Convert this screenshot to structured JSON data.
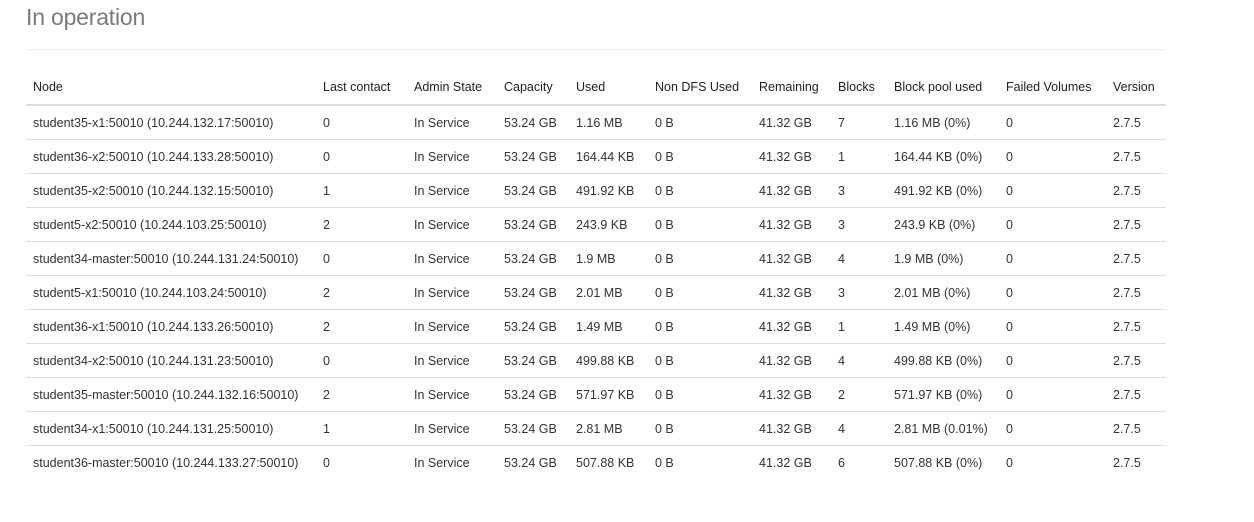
{
  "section": {
    "title": "In operation"
  },
  "table": {
    "headers": [
      "Node",
      "Last contact",
      "Admin State",
      "Capacity",
      "Used",
      "Non DFS Used",
      "Remaining",
      "Blocks",
      "Block pool used",
      "Failed Volumes",
      "Version"
    ],
    "rows": [
      [
        "student35-x1:50010 (10.244.132.17:50010)",
        "0",
        "In Service",
        "53.24 GB",
        "1.16 MB",
        "0 B",
        "41.32 GB",
        "7",
        "1.16 MB (0%)",
        "0",
        "2.7.5"
      ],
      [
        "student36-x2:50010 (10.244.133.28:50010)",
        "0",
        "In Service",
        "53.24 GB",
        "164.44 KB",
        "0 B",
        "41.32 GB",
        "1",
        "164.44 KB (0%)",
        "0",
        "2.7.5"
      ],
      [
        "student35-x2:50010 (10.244.132.15:50010)",
        "1",
        "In Service",
        "53.24 GB",
        "491.92 KB",
        "0 B",
        "41.32 GB",
        "3",
        "491.92 KB (0%)",
        "0",
        "2.7.5"
      ],
      [
        "student5-x2:50010 (10.244.103.25:50010)",
        "2",
        "In Service",
        "53.24 GB",
        "243.9 KB",
        "0 B",
        "41.32 GB",
        "3",
        "243.9 KB (0%)",
        "0",
        "2.7.5"
      ],
      [
        "student34-master:50010 (10.244.131.24:50010)",
        "0",
        "In Service",
        "53.24 GB",
        "1.9 MB",
        "0 B",
        "41.32 GB",
        "4",
        "1.9 MB (0%)",
        "0",
        "2.7.5"
      ],
      [
        "student5-x1:50010 (10.244.103.24:50010)",
        "2",
        "In Service",
        "53.24 GB",
        "2.01 MB",
        "0 B",
        "41.32 GB",
        "3",
        "2.01 MB (0%)",
        "0",
        "2.7.5"
      ],
      [
        "student36-x1:50010 (10.244.133.26:50010)",
        "2",
        "In Service",
        "53.24 GB",
        "1.49 MB",
        "0 B",
        "41.32 GB",
        "1",
        "1.49 MB (0%)",
        "0",
        "2.7.5"
      ],
      [
        "student34-x2:50010 (10.244.131.23:50010)",
        "0",
        "In Service",
        "53.24 GB",
        "499.88 KB",
        "0 B",
        "41.32 GB",
        "4",
        "499.88 KB (0%)",
        "0",
        "2.7.5"
      ],
      [
        "student35-master:50010 (10.244.132.16:50010)",
        "2",
        "In Service",
        "53.24 GB",
        "571.97 KB",
        "0 B",
        "41.32 GB",
        "2",
        "571.97 KB (0%)",
        "0",
        "2.7.5"
      ],
      [
        "student34-x1:50010 (10.244.131.25:50010)",
        "1",
        "In Service",
        "53.24 GB",
        "2.81 MB",
        "0 B",
        "41.32 GB",
        "4",
        "2.81 MB (0.01%)",
        "0",
        "2.7.5"
      ],
      [
        "student36-master:50010 (10.244.133.27:50010)",
        "0",
        "In Service",
        "53.24 GB",
        "507.88 KB",
        "0 B",
        "41.32 GB",
        "6",
        "507.88 KB (0%)",
        "0",
        "2.7.5"
      ]
    ]
  }
}
